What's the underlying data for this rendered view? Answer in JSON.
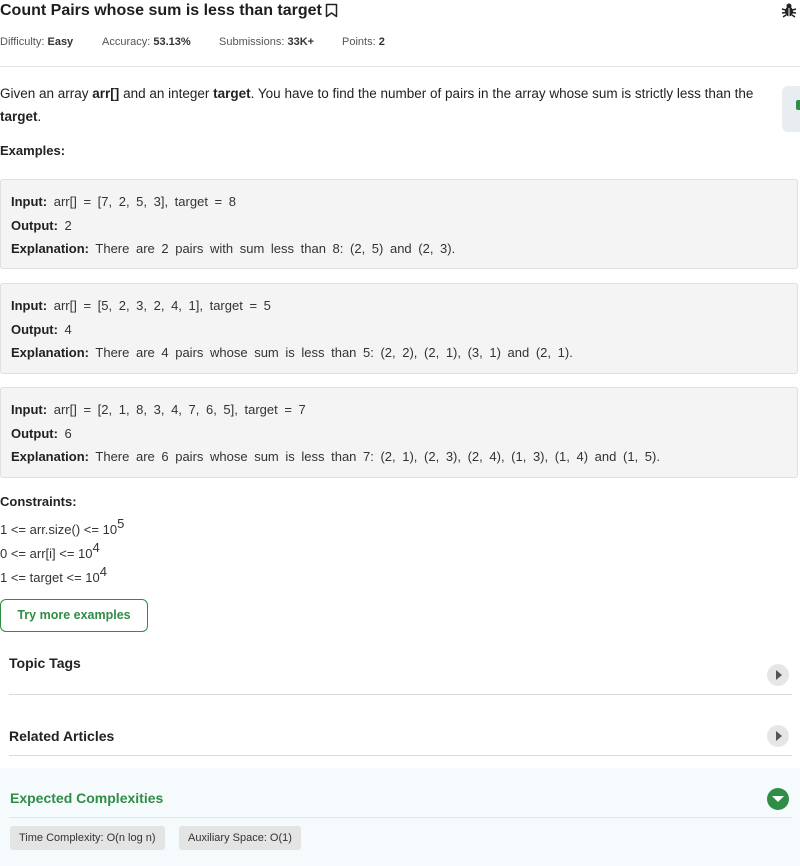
{
  "problem": {
    "title": "Count Pairs whose sum is less than target",
    "difficulty_label": "Difficulty:",
    "difficulty_value": "Easy",
    "accuracy_label": "Accuracy:",
    "accuracy_value": "53.13%",
    "submissions_label": "Submissions:",
    "submissions_value": "33K+",
    "points_label": "Points:",
    "points_value": "2",
    "statement": {
      "p1": "Given an array ",
      "arr": "arr[]",
      "p2": " and an integer ",
      "target": "target",
      "p3": ". You have to find the number of pairs in the array whose sum is strictly less than the ",
      "target2": "target",
      "p4": "."
    },
    "examples_label": "Examples:",
    "examples": [
      {
        "input_label": "Input:",
        "input": "arr[] = [7, 2, 5, 3], target = 8",
        "output_label": "Output:",
        "output": "2",
        "explanation_label": "Explanation:",
        "explanation": "There are 2 pairs with sum less than 8: (2, 5) and (2, 3)."
      },
      {
        "input_label": "Input:",
        "input": "arr[] = [5, 2, 3, 2, 4, 1], target = 5",
        "output_label": "Output:",
        "output": "4",
        "explanation_label": "Explanation:",
        "explanation": "There are 4 pairs whose sum is less than 5: (2, 2), (2, 1), (3, 1) and (2, 1)."
      },
      {
        "input_label": "Input:",
        "input": "arr[] = [2, 1, 8, 3, 4, 7, 6, 5], target = 7",
        "output_label": "Output:",
        "output": "6",
        "explanation_label": "Explanation:",
        "explanation": "There are 6 pairs whose sum is less than 7: (2, 1), (2, 3), (2, 4), (1, 3), (1, 4) and (1, 5)."
      }
    ],
    "constraints_label": "Constraints:",
    "constraints": [
      {
        "text": "1 <= arr.size() <= 10",
        "exp": "5"
      },
      {
        "text": "0 <= arr[i] <= 10",
        "exp": "4"
      },
      {
        "text": "1 <= target <= 10",
        "exp": "4"
      }
    ],
    "try_more_label": "Try more examples"
  },
  "sections": {
    "topic_tags": "Topic Tags",
    "related_articles": "Related Articles",
    "expected_complexities": "Expected Complexities",
    "time_complexity": "Time Complexity: O(n log n)",
    "auxiliary_space": "Auxiliary Space: O(1)"
  },
  "icons": {
    "bookmark": "bookmark-icon",
    "bug": "bug-icon",
    "chevron_right": "chevron-right-icon",
    "chevron_down": "chevron-down-icon"
  },
  "colors": {
    "accent_green": "#2f8d46",
    "example_bg": "#f4f4f4",
    "expected_bg": "#f5fafc"
  }
}
